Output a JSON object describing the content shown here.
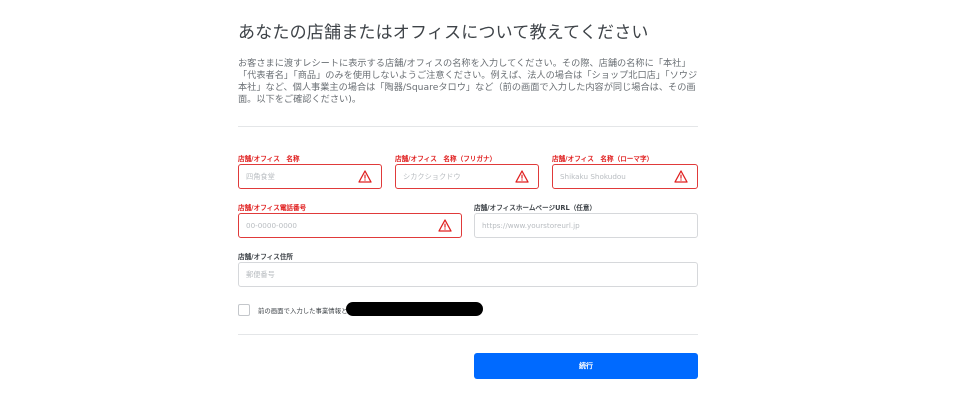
{
  "header": {
    "title": "あなたの店舗またはオフィスについて教えてください"
  },
  "description": "お客さまに渡すレシートに表示する店舗/オフィスの名称を入力してください。その際、店舗の名称に「本社」「代表者名」「商品」のみを使用しないようご注意ください。例えば、法人の場合は「ショップ北口店」「ソウジ本社」など、個人事業主の場合は「陶器/Squareタロウ」など（前の画面で入力した内容が同じ場合は、その画面。以下をご確認ください)。",
  "form": {
    "name": {
      "label": "店舗/オフィス　名称",
      "placeholder": "四角食堂",
      "value": ""
    },
    "name_kana": {
      "label": "店舗/オフィス　名称（フリガナ）",
      "placeholder": "シカクショクドウ",
      "value": ""
    },
    "name_roman": {
      "label": "店舗/オフィス　名称（ローマ字）",
      "placeholder": "Shikaku Shokudou",
      "value": ""
    },
    "phone": {
      "label": "店舗/オフィス電話番号",
      "placeholder": "00-0000-0000",
      "value": ""
    },
    "homepage": {
      "label": "店舗/オフィスホームページURL（任意）",
      "placeholder": "https://www.yourstoreurl.jp",
      "value": ""
    },
    "address": {
      "label": "店舗/オフィス住所",
      "placeholder": "郵便番号",
      "value": ""
    },
    "same_as_previous": {
      "label": "前の画面で入力した事業情報と同情報",
      "checked": false
    }
  },
  "actions": {
    "continue_label": "続行"
  },
  "icons": {
    "error": "warning-icon",
    "redaction": "redacted-text"
  },
  "colors": {
    "error": "#e02020",
    "primary": "#006aff",
    "border": "#d6d8db"
  }
}
